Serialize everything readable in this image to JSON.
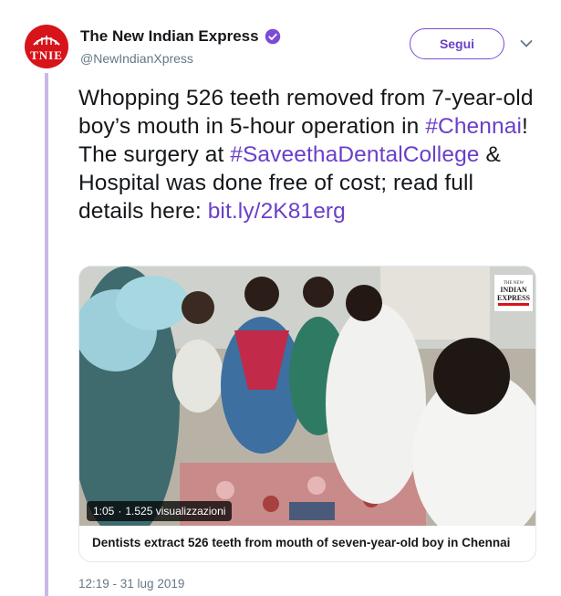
{
  "author": {
    "display_name": "The New Indian Express",
    "handle": "@NewIndianXpress",
    "avatar_text": "TNIE",
    "verified": true
  },
  "follow_label": "Segui",
  "tweet": {
    "t1": "Whopping 526 teeth removed from 7-year-old boy’s mouth in 5-hour operation in ",
    "hashtag1": "#Chennai",
    "t2": "!",
    "t3": "The surgery at ",
    "hashtag2": "#SaveethaDentalCollege",
    "t4": " & Hospital was done free of cost; read full details here: ",
    "link": "bit.ly/2K81erg"
  },
  "media": {
    "duration": "1:05",
    "separator": "·",
    "views": "1.525 visualizzazioni",
    "logo_line1": "THE NEW",
    "logo_line2": "INDIAN",
    "logo_line3": "EXPRESS",
    "card_title": "Dentists extract 526 teeth from mouth of seven-year-old boy in Chennai"
  },
  "timestamp": "12:19 - 31 lug 2019",
  "colors": {
    "accent": "#6a3fc9",
    "thread_line": "#c9b8e8",
    "brand_red": "#d7141a"
  },
  "icons": [
    "verified-icon",
    "chevron-down-icon"
  ]
}
